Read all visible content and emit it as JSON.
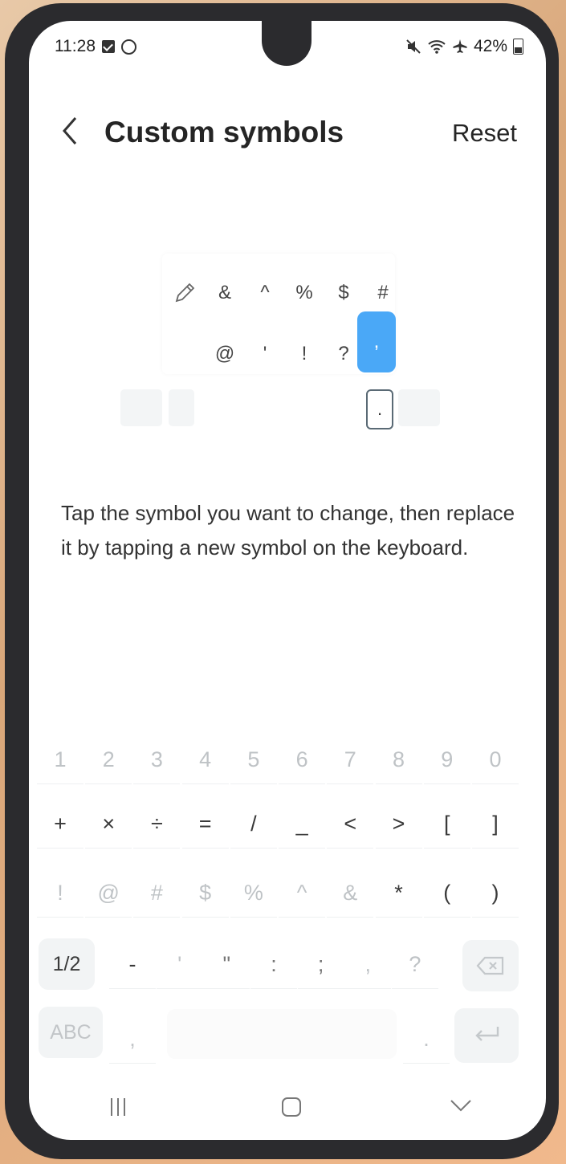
{
  "status_bar": {
    "time": "11:28",
    "battery": "42%"
  },
  "header": {
    "title": "Custom symbols",
    "reset_label": "Reset"
  },
  "preview": {
    "row1": [
      "&",
      "^",
      "%",
      "$",
      "#"
    ],
    "row2": [
      "@",
      "'",
      "!",
      "?"
    ],
    "selected_symbol": ",",
    "bottom_symbol": "."
  },
  "instructions": "Tap the symbol you want to change, then replace it by tapping a new symbol on the keyboard.",
  "keyboard": {
    "row1": [
      "1",
      "2",
      "3",
      "4",
      "5",
      "6",
      "7",
      "8",
      "9",
      "0"
    ],
    "row2": [
      "+",
      "×",
      "÷",
      "=",
      "/",
      "_",
      "<",
      ">",
      "[",
      "]"
    ],
    "row3": [
      "!",
      "@",
      "#",
      "$",
      "%",
      "^",
      "&",
      "*",
      "(",
      ")"
    ],
    "row4": [
      "-",
      "'",
      "\"",
      ":",
      ";",
      ",",
      "?"
    ],
    "page_label": "1/2",
    "abc_label": "ABC",
    "comma": ",",
    "period": "."
  },
  "colors": {
    "accent": "#4aa8f7",
    "title": "#252525"
  }
}
